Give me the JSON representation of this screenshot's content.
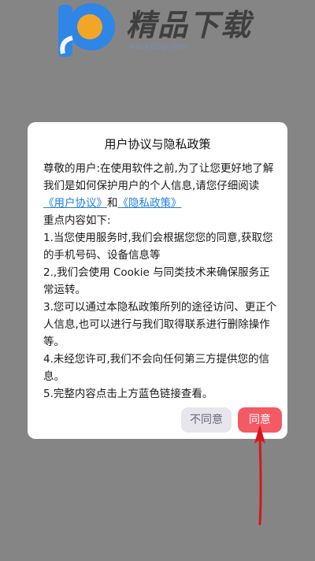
{
  "watermark": {
    "title": "精品下载",
    "url": "www.jb9p.com"
  },
  "dialog": {
    "title": "用户协议与隐私政策",
    "intro_before": "尊敬的用户:在使用软件之前,为了让您更好地了解我们是如何保护用户的个人信息,请您仔细阅读",
    "link_user_agreement": "《用户协议》",
    "and_text": "和",
    "link_privacy_policy": "《隐私政策》",
    "points_header": "重点内容如下:",
    "points": [
      "1.当您使用服务时,我们会根据您您的同意,获取您的手机号码、设备信息等",
      "2.,我们会使用 Cookie 与同类技术来确保服务正常运转。",
      "3.您可以通过本隐私政策所列的途径访问、更正个人信息,也可以进行与我们取得联系进行删除操作等。",
      "4.未经您许可,我们不会向任何第三方提供您的信息。",
      "5.完整内容点击上方蓝色链接查看。"
    ],
    "disagree_label": "不同意",
    "agree_label": "同意"
  },
  "colors": {
    "overlay": "#858585",
    "link": "#1f7fe0",
    "agree_button": "#f25a64",
    "disagree_button": "#e6e6ec",
    "annotation_arrow": "#d9151b"
  }
}
